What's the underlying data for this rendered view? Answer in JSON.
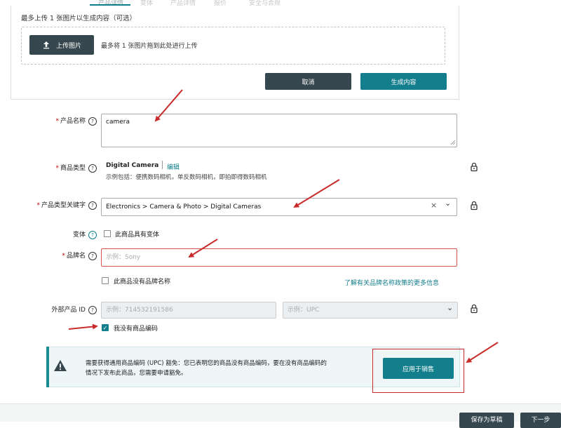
{
  "tabs": [
    {
      "label": "产品详情",
      "active": true
    },
    {
      "label": "变体"
    },
    {
      "label": "产品详情"
    },
    {
      "label": "报价"
    },
    {
      "label": "安全与合规"
    }
  ],
  "upload": {
    "label": "最多上传 1 张图片以生成内容（可选）",
    "button_label": "上传图片",
    "drop_hint": "最多将 1 张图片拖到此处进行上传",
    "cancel_label": "取消",
    "generate_label": "生成内容"
  },
  "fields": {
    "product_name": {
      "label": "产品名称",
      "value": "camera"
    },
    "product_type": {
      "label": "商品类型",
      "value": "Digital Camera",
      "edit_label": "编辑",
      "examples": "示例包括：便携数码相机，单反数码相机，即拍即得数码相机"
    },
    "browse_keyword": {
      "label": "产品类型关键字",
      "value": "Electronics > Camera & Photo > Digital Cameras",
      "clear_glyph": "×",
      "dropdown_glyph": "⌄"
    },
    "variation": {
      "label": "变体",
      "checkbox_label": "此商品具有变体"
    },
    "brand": {
      "label": "品牌名",
      "placeholder": "示例：Sony",
      "no_brand_label": "此商品没有品牌名称",
      "learn_more_link": "了解有关品牌名称政策的更多信息"
    },
    "external_id": {
      "label": "外部产品 ID",
      "placeholder": "示例：714532191586",
      "type_placeholder": "示例：UPC",
      "no_code_label": "我没有商品编码"
    }
  },
  "alert": {
    "text": "需要获得通用商品编码 (UPC) 豁免：您已表明您的商品没有商品编码，要在没有商品编码的情况下发布此商品，您需要申请豁免。",
    "apply_label": "应用于销售"
  },
  "footer": {
    "save_draft_label": "保存为草稿",
    "next_label": "下一步"
  },
  "icons": {
    "help": "?",
    "check": "✓"
  },
  "colors": {
    "primary_teal": "#137e8c",
    "dark_button": "#37474f",
    "required_red": "#c40000",
    "annotation_red": "#c92b2b"
  }
}
